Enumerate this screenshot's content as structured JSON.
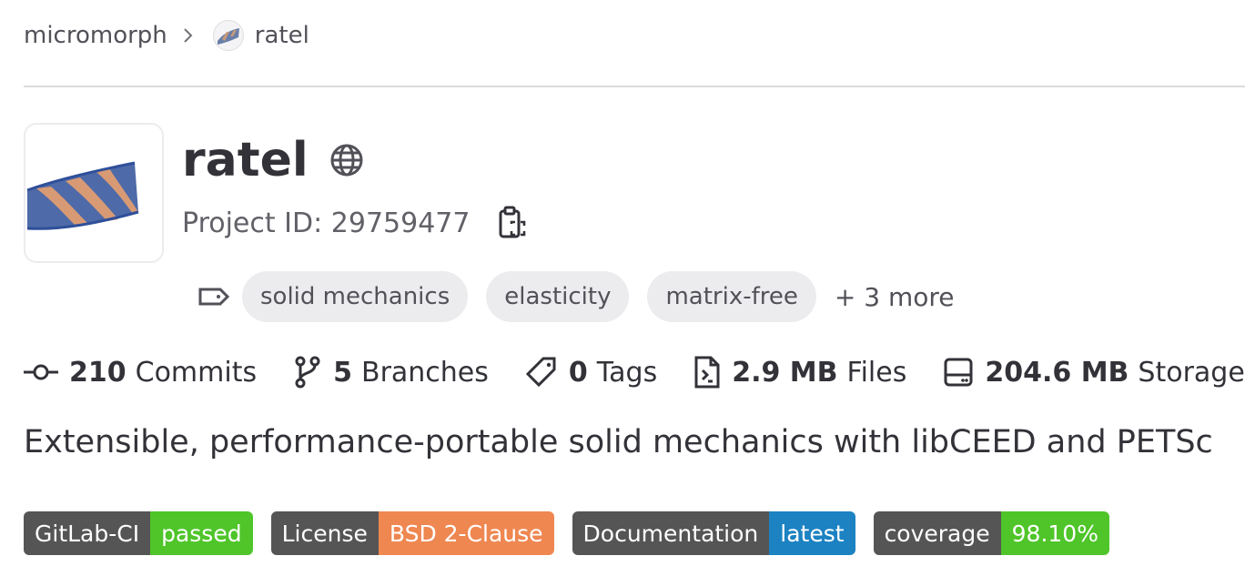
{
  "breadcrumb": {
    "group": "micromorph",
    "project": "ratel"
  },
  "project": {
    "name": "ratel",
    "project_id_label": "Project ID: 29759477"
  },
  "topics": {
    "items": [
      "solid mechanics",
      "elasticity",
      "matrix-free"
    ],
    "more": "+ 3 more"
  },
  "stats": {
    "commits": {
      "value": "210",
      "label": "Commits"
    },
    "branches": {
      "value": "5",
      "label": "Branches"
    },
    "tags": {
      "value": "0",
      "label": "Tags"
    },
    "files": {
      "value": "2.9 MB",
      "label": "Files"
    },
    "storage": {
      "value": "204.6 MB",
      "label": "Storage"
    }
  },
  "description": "Extensible, performance-portable solid mechanics with libCEED and PETSc",
  "badges": [
    {
      "label": "GitLab-CI",
      "value": "passed",
      "color": "#4fc52a"
    },
    {
      "label": "License",
      "value": "BSD 2-Clause",
      "color": "#ef8751"
    },
    {
      "label": "Documentation",
      "value": "latest",
      "color": "#1c82c2"
    },
    {
      "label": "coverage",
      "value": "98.10%",
      "color": "#4fc52a"
    }
  ],
  "icons": [
    "chevron-right-icon",
    "globe-icon",
    "copy-icon",
    "label-icon",
    "commit-icon",
    "branch-icon",
    "tag-icon",
    "file-icon",
    "storage-icon"
  ]
}
